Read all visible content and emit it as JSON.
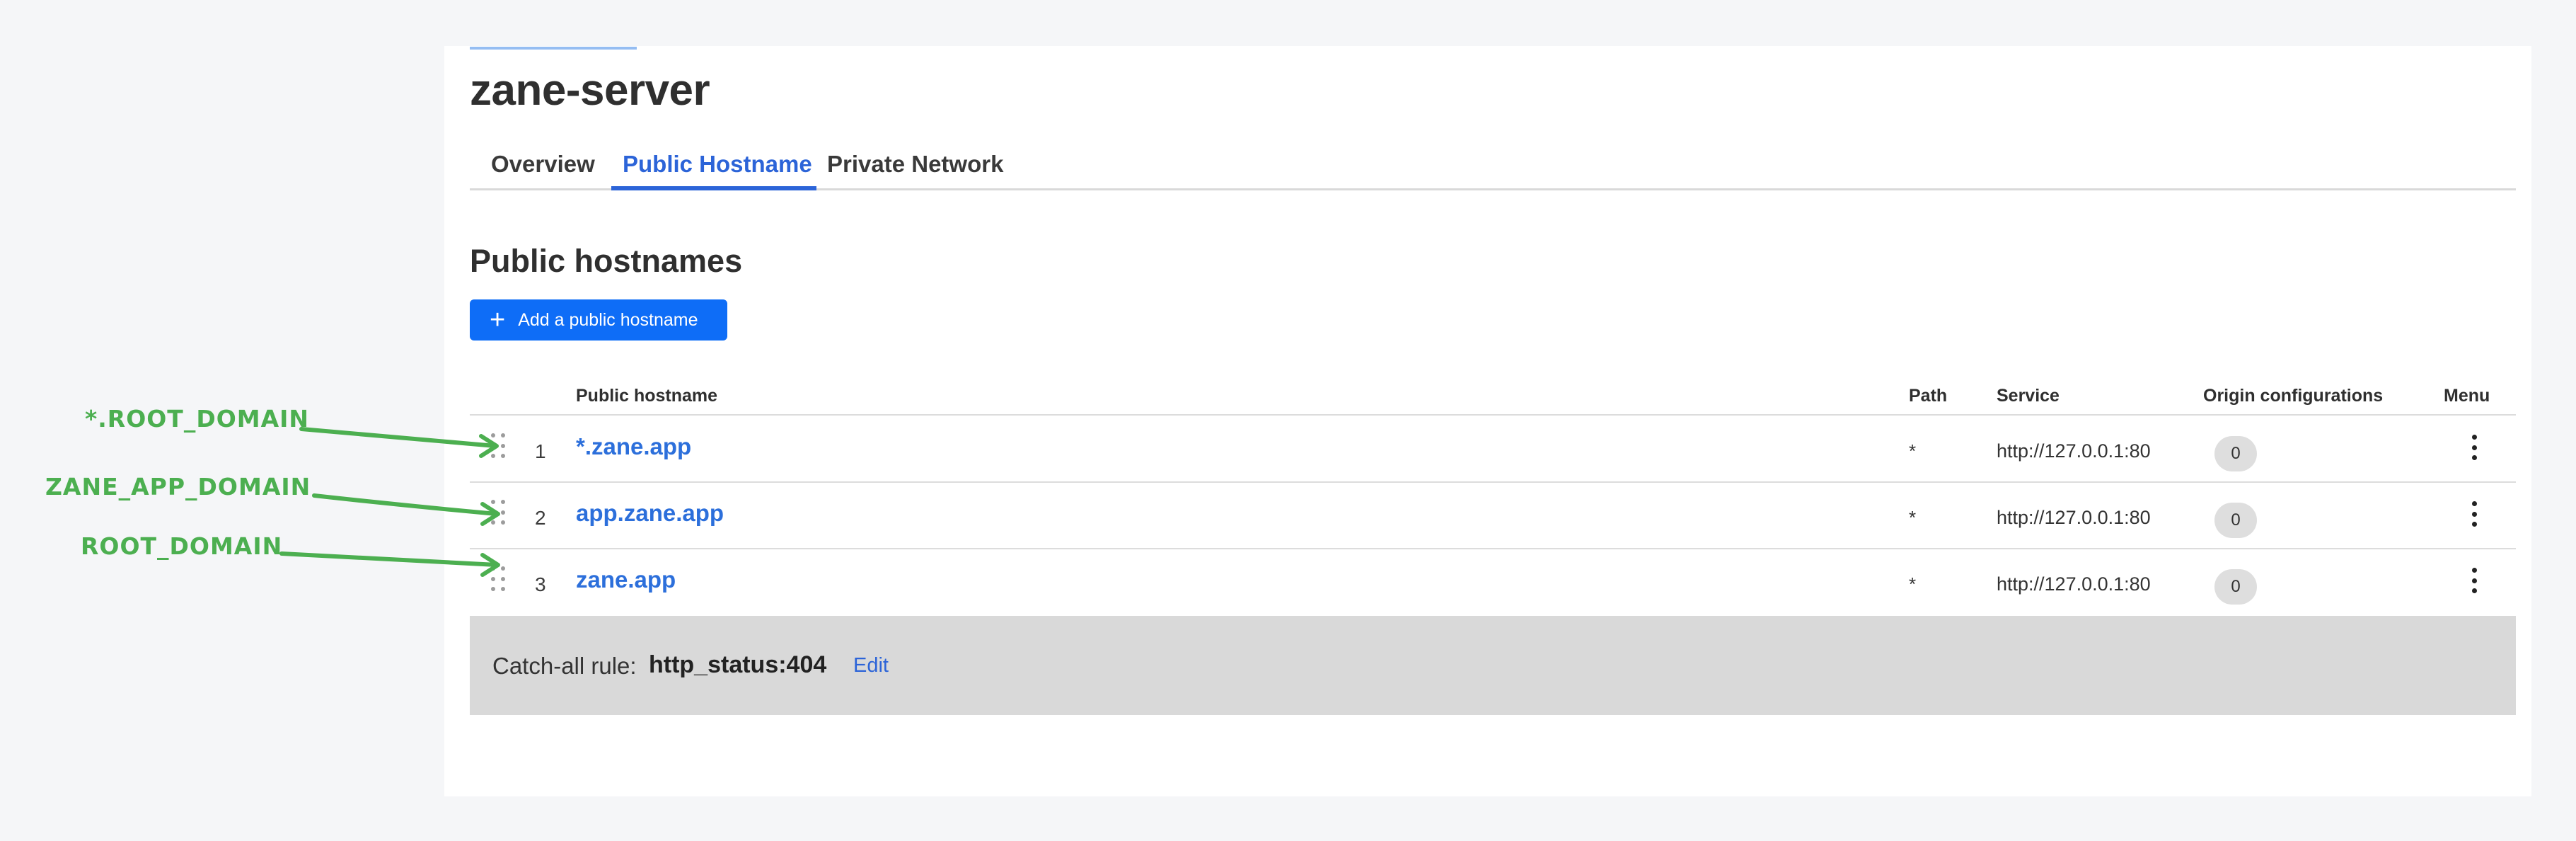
{
  "page": {
    "title": "zane-server",
    "section_title": "Public hostnames",
    "add_button_label": "Add a public hostname"
  },
  "tabs": [
    {
      "label": "Overview",
      "active": false
    },
    {
      "label": "Public Hostname",
      "active": true
    },
    {
      "label": "Private Network",
      "active": false
    }
  ],
  "table": {
    "headers": {
      "hostname": "Public hostname",
      "path": "Path",
      "service": "Service",
      "origin": "Origin configurations",
      "menu": "Menu"
    },
    "rows": [
      {
        "num": "1",
        "hostname": "*.zane.app",
        "path": "*",
        "service": "http://127.0.0.1:80",
        "origin_count": "0"
      },
      {
        "num": "2",
        "hostname": "app.zane.app",
        "path": "*",
        "service": "http://127.0.0.1:80",
        "origin_count": "0"
      },
      {
        "num": "3",
        "hostname": "zane.app",
        "path": "*",
        "service": "http://127.0.0.1:80",
        "origin_count": "0"
      }
    ]
  },
  "catch_all": {
    "label": "Catch-all rule:",
    "value": "http_status:404",
    "edit_label": "Edit"
  },
  "annotations": [
    {
      "text": "*.ROOT_DOMAIN"
    },
    {
      "text": "ZANE_APP_DOMAIN"
    },
    {
      "text": "ROOT_DOMAIN"
    }
  ],
  "colors": {
    "accent": "#2c64d8",
    "button": "#0e6df7",
    "annotation": "#4caf50",
    "catch_all_bg": "#d9d9d9"
  }
}
